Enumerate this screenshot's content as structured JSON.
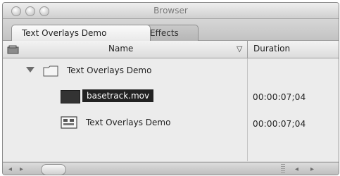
{
  "window": {
    "title": "Browser"
  },
  "tabs": [
    {
      "label": "Text Overlays Demo",
      "active": true
    },
    {
      "label": "Effects",
      "active": false
    }
  ],
  "columns": {
    "name": "Name",
    "duration": "Duration",
    "sort_indicator": "▽"
  },
  "items": [
    {
      "name": "Text Overlays Demo",
      "type": "bin",
      "expanded": true,
      "duration": ""
    },
    {
      "name": "basetrack.mov",
      "type": "clip",
      "selected": true,
      "duration": "00:00:07;04"
    },
    {
      "name": "Text Overlays Demo",
      "type": "sequence",
      "selected": false,
      "duration": "00:00:07;04"
    }
  ],
  "scrollbar": {
    "left_arrow": "◂",
    "right_arrow": "▸",
    "mini_left": "◂",
    "mini_right": "▸"
  },
  "colors": {
    "selection_bg": "#222222",
    "window_bg": "#d9d9d9",
    "list_bg": "#ececec"
  }
}
